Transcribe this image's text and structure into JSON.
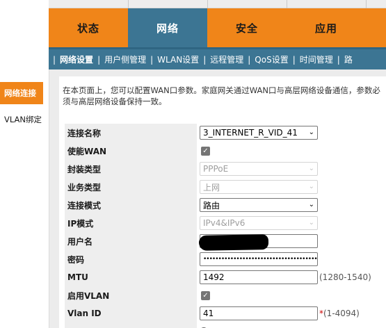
{
  "top_tabs": [
    {
      "label": "状态"
    },
    {
      "label": "网络"
    },
    {
      "label": "安全"
    },
    {
      "label": "应用"
    }
  ],
  "sub_nav": [
    {
      "label": "网络设置"
    },
    {
      "label": "用户侧管理"
    },
    {
      "label": "WLAN设置"
    },
    {
      "label": "远程管理"
    },
    {
      "label": "QoS设置"
    },
    {
      "label": "时间管理"
    },
    {
      "label": "路"
    }
  ],
  "side_nav": [
    {
      "label": "网络连接"
    },
    {
      "label": "VLAN绑定"
    }
  ],
  "intro": "在本页面上，您可以配置WAN口参数。家庭网关通过WAN口与高层网络设备通信，参数必须与高层网络设备保持一致。",
  "form": {
    "connection_name": {
      "label": "连接名称",
      "value": "3_INTERNET_R_VID_41"
    },
    "enable_wan": {
      "label": "使能WAN"
    },
    "encapsulation": {
      "label": "封装类型",
      "value": "PPPoE"
    },
    "service_type": {
      "label": "业务类型",
      "value": "上网"
    },
    "connection_mode": {
      "label": "连接模式",
      "value": "路由"
    },
    "ip_mode": {
      "label": "IP模式",
      "value": "IPv4&IPv6"
    },
    "username": {
      "label": "用户名"
    },
    "password": {
      "label": "密码",
      "value": "•••••••••••••••••••••••••••••••••••••••"
    },
    "mtu": {
      "label": "MTU",
      "value": "1492",
      "hint": "(1280-1540)"
    },
    "enable_vlan": {
      "label": "启用VLAN"
    },
    "vlan_id": {
      "label": "Vlan ID",
      "value": "41",
      "hint_mark": "*",
      "hint": "(1-4094)"
    }
  },
  "colors": {
    "accent_orange": "#f08519",
    "nav_blue": "#3c7593"
  }
}
